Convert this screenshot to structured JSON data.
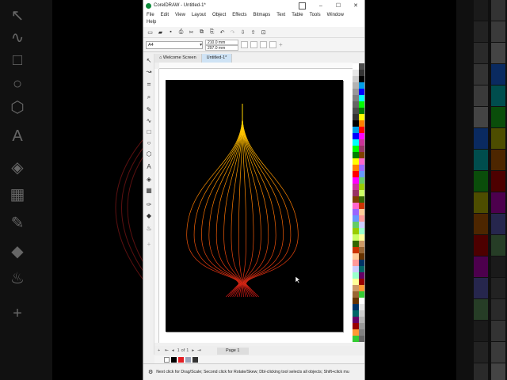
{
  "window": {
    "title": "CorelDRAW - Untitled-1*",
    "minimize": "–",
    "maximize": "☐",
    "close": "✕"
  },
  "menu": [
    "File",
    "Edit",
    "View",
    "Layout",
    "Object",
    "Effects",
    "Bitmaps",
    "Text",
    "Table",
    "Tools",
    "Window",
    "Help"
  ],
  "property_bar": {
    "page_size": "A4",
    "width": "210.0 mm",
    "height": "297.0 mm"
  },
  "tabs": [
    {
      "label": "Welcome Screen",
      "active": false
    },
    {
      "label": "Untitled-1*",
      "active": true
    }
  ],
  "page_nav": {
    "current": "1",
    "of_label": "of",
    "total": "1",
    "page_tab": "Page 1"
  },
  "status": "Next click for Drag/Scale; Second click for Rotate/Skew; Dbl-clicking tool selects all objects; Shift+click mu",
  "colors": {
    "accent": "#0d8b3a",
    "stroke_top": "#ffd400",
    "stroke_mid": "#ff7a00",
    "stroke_bottom": "#d81818"
  },
  "palette": [
    "#ffffff",
    "#000000",
    "#1a1a1a",
    "#333333",
    "#4d4d4d",
    "#666666",
    "#808080",
    "#999999",
    "#b3b3b3",
    "#cccccc",
    "#e6e6e6",
    "#00a0e9",
    "#00ff00",
    "#008000",
    "#ffff00",
    "#ff0000",
    "#ff00ff",
    "#0000ff",
    "#00ffff",
    "#ff8000",
    "#804000",
    "#ff66cc",
    "#9966ff",
    "#66cc66",
    "#99cc00",
    "#ccff66",
    "#336600",
    "#cc3300",
    "#993366",
    "#6699ff"
  ],
  "icons": {
    "new": "new-document-icon",
    "open": "open-icon",
    "save": "save-icon",
    "print": "print-icon",
    "undo": "undo-icon",
    "redo": "redo-icon",
    "import": "import-icon",
    "export": "export-icon",
    "pick": "pick-tool-icon",
    "shape": "shape-tool-icon",
    "crop": "crop-tool-icon",
    "zoom": "zoom-tool-icon",
    "freehand": "freehand-tool-icon",
    "rectangle": "rectangle-tool-icon",
    "ellipse": "ellipse-tool-icon",
    "polygon": "polygon-tool-icon",
    "text": "text-tool-icon",
    "fill": "fill-tool-icon"
  }
}
